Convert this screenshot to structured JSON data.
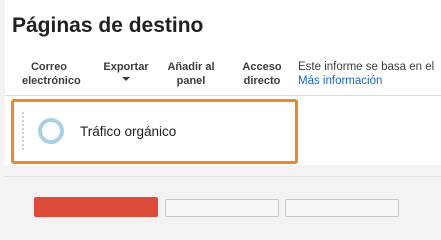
{
  "header": {
    "title": "Páginas de destino"
  },
  "toolbar": {
    "email": {
      "line1": "Correo",
      "line2": "electrónico"
    },
    "export": {
      "label": "Exportar"
    },
    "add_panel": {
      "line1": "Añadir al",
      "line2": "panel"
    },
    "shortcut": {
      "line1": "Acceso",
      "line2": "directo"
    }
  },
  "info": {
    "text": "Este informe se basa en el",
    "link": "Más información"
  },
  "segment": {
    "label": "Tráfico orgánico",
    "icon": "circle-segment-icon"
  },
  "colors": {
    "highlight": "#ea8a2b",
    "link": "#1a66c2",
    "segment_ring": "#a9d0e6",
    "red_button": "#dd4b39"
  }
}
